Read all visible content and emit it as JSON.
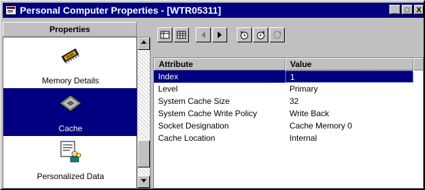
{
  "window": {
    "title": "Personal Computer Properties - [WTR05311]",
    "buttons": {
      "minimize": "_",
      "maximize": "□",
      "close": "X"
    }
  },
  "left_panel": {
    "header": "Properties",
    "items": [
      {
        "label": "Memory Details",
        "icon": "ram-chip-icon",
        "selected": false
      },
      {
        "label": "Cache",
        "icon": "cpu-chip-icon",
        "selected": true
      },
      {
        "label": "Personalized Data",
        "icon": "user-document-icon",
        "selected": false
      }
    ]
  },
  "toolbar": {
    "buttons": [
      {
        "icon": "form-view-icon",
        "enabled": true
      },
      {
        "icon": "table-view-icon",
        "enabled": true
      },
      {
        "icon": "previous-arrow-icon",
        "enabled": false
      },
      {
        "icon": "next-arrow-icon",
        "enabled": true
      },
      {
        "icon": "history-icon",
        "enabled": true
      },
      {
        "icon": "history-back-icon",
        "enabled": true
      },
      {
        "icon": "refresh-icon",
        "enabled": false
      }
    ]
  },
  "grid": {
    "columns": [
      "Attribute",
      "Value"
    ],
    "rows": [
      {
        "attribute": "Index",
        "value": "1",
        "selected": true
      },
      {
        "attribute": "Level",
        "value": "Primary",
        "selected": false
      },
      {
        "attribute": "System Cache Size",
        "value": "32",
        "selected": false
      },
      {
        "attribute": "System Cache Write Policy",
        "value": "Write Back",
        "selected": false
      },
      {
        "attribute": "Socket Designation",
        "value": "Cache Memory 0",
        "selected": false
      },
      {
        "attribute": "Cache Location",
        "value": "Internal",
        "selected": false
      }
    ]
  },
  "colors": {
    "selection": "#000080",
    "titlebar": "#000080",
    "face": "#c0c0c0"
  }
}
